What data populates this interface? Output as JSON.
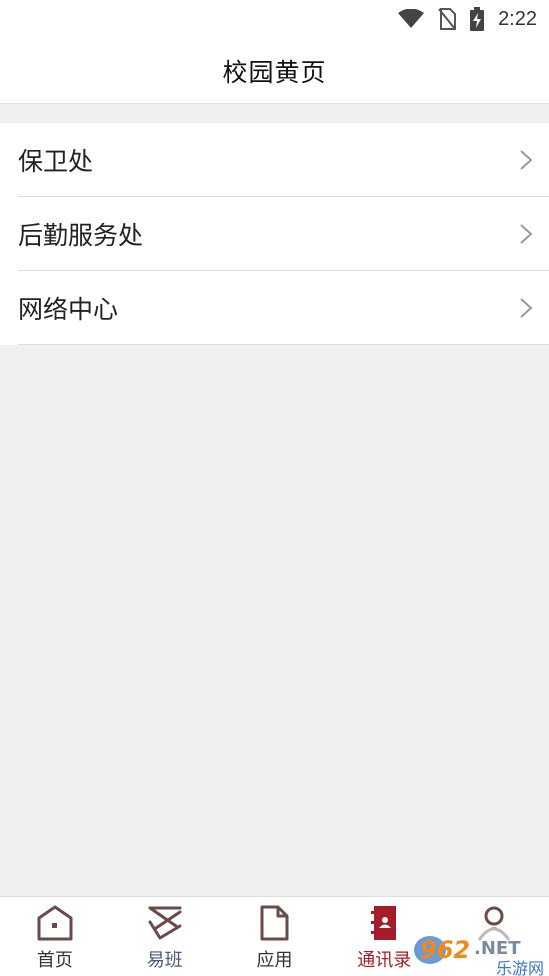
{
  "status_bar": {
    "time": "2:22",
    "icons": [
      "wifi-icon",
      "no-sim-icon",
      "battery-charging-icon"
    ]
  },
  "header": {
    "title": "校园黄页"
  },
  "directory": {
    "items": [
      {
        "label": "保卫处",
        "icon": "chevron-right-icon"
      },
      {
        "label": "后勤服务处",
        "icon": "chevron-right-icon"
      },
      {
        "label": "网络中心",
        "icon": "chevron-right-icon"
      }
    ]
  },
  "bottom_nav": {
    "items": [
      {
        "label": "首页",
        "icon": "home-icon"
      },
      {
        "label": "易班",
        "icon": "yiban-icon"
      },
      {
        "label": "应用",
        "icon": "document-icon"
      },
      {
        "label": "通讯录",
        "icon": "contacts-book-icon"
      },
      {
        "label": "",
        "icon": "person-icon"
      }
    ],
    "active_index": 3
  },
  "watermark": {
    "text": "962.NET",
    "subtext": "乐游网"
  },
  "colors": {
    "accent": "#a51d2a",
    "icon_brown": "#6b4a4a",
    "background": "#f0f0f0",
    "orange": "#f08a1c",
    "blue": "#3a78c8"
  }
}
